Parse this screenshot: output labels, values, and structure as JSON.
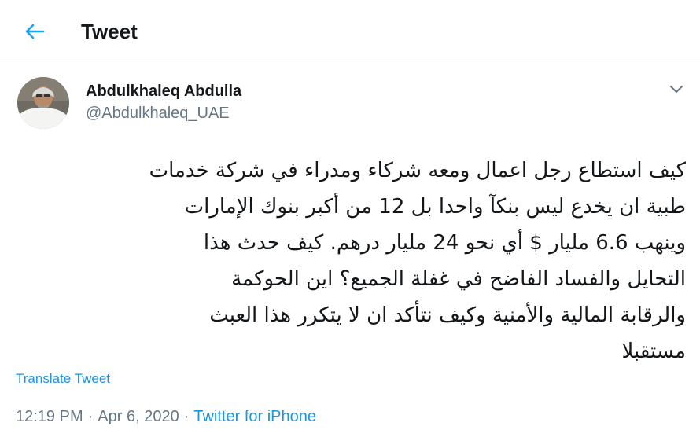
{
  "header": {
    "title": "Tweet",
    "back_icon": "arrow-left-icon",
    "accent_color": "#1da1f2"
  },
  "tweet": {
    "author_name": "Abdulkhaleq Abdulla",
    "author_handle": "@Abdulkhaleq_UAE",
    "text": "كيف استطاع رجل اعمال ومعه شركاء ومدراء في شركة خدمات\nطبية ان يخدع ليس بنكآ واحدا بل 12 من أكبر بنوك الإمارات\nوينهب 6.6 مليار $ أي نحو 24 مليار درهم. كيف حدث هذا\nالتحايل والفساد الفاضح في غفلة الجميع؟ اين الحوكمة\nوالرقابة المالية والأمنية وكيف نتأكد ان لا يتكرر هذا العبث\nمستقبلا",
    "translate_label": "Translate Tweet",
    "time": "12:19 PM",
    "separator": "·",
    "date": "Apr 6, 2020",
    "source": "Twitter for iPhone",
    "caret_icon": "chevron-down-icon"
  },
  "colors": {
    "link": "#1b95e0",
    "secondary_text": "#657786",
    "divider": "#e6ecf0"
  }
}
